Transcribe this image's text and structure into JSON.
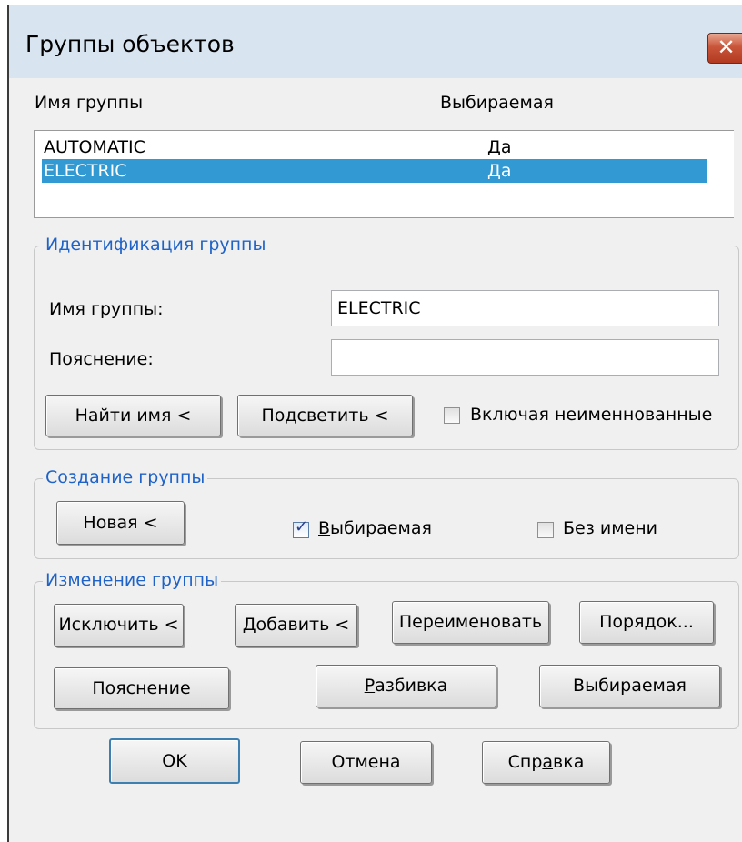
{
  "window": {
    "title": "Группы  объектов",
    "close_glyph": "✕"
  },
  "list": {
    "columns": [
      "Имя группы",
      "Выбираемая"
    ],
    "rows": [
      {
        "name": "AUTOMATIC",
        "selectable": "Да",
        "selected": false
      },
      {
        "name": "ELECTRIC",
        "selectable": "Да",
        "selected": true
      }
    ],
    "selection_color": "#3399d3"
  },
  "identification": {
    "legend": "Идентификация группы",
    "name_label": "Имя группы:",
    "name_value": "ELECTRIC",
    "desc_label": "Пояснение:",
    "desc_value": "",
    "find_name_button": "Найти имя <",
    "highlight_button": "Подсветить <",
    "include_unnamed_label": "Включая неименнованные",
    "include_unnamed_checked": false
  },
  "create": {
    "legend": "Создание группы",
    "new_button": "Новая <",
    "selectable_label_first": "В",
    "selectable_label_rest": "ыбираемая",
    "selectable_checked": true,
    "unnamed_label": "Без имени",
    "unnamed_checked": false
  },
  "change": {
    "legend": "Изменение группы",
    "remove_button": "Исключить <",
    "add_button": "Добавить <",
    "rename_button": "Переименовать",
    "order_button": "Порядок...",
    "description_button": "Пояснение",
    "explode_button_first": "Р",
    "explode_button_rest": "азбивка",
    "selectable_button": "Выбираемая"
  },
  "footer": {
    "ok_button": "OK",
    "cancel_button": "Отмена",
    "help_button_a": "Спр",
    "help_button_u": "а",
    "help_button_b": "вка"
  },
  "accent_color": "#1f63c8"
}
